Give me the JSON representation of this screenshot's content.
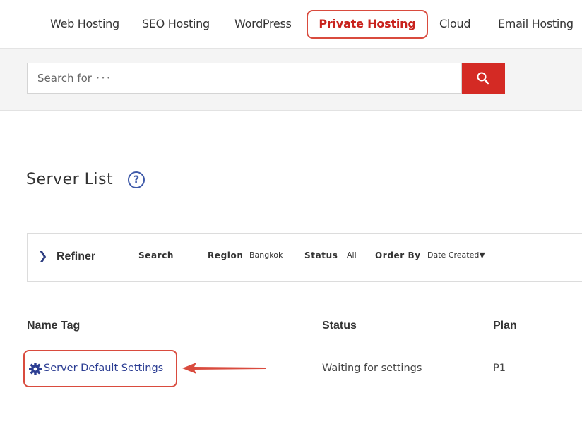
{
  "nav": {
    "items": [
      "Web Hosting",
      "SEO Hosting",
      "WordPress",
      "Private Hosting",
      "Cloud",
      "Email Hosting"
    ],
    "active": "Private Hosting"
  },
  "search": {
    "placeholder": "Search for ･･･"
  },
  "page": {
    "title": "Server List",
    "help_glyph": "?"
  },
  "refiner": {
    "label": "Refiner",
    "filters": {
      "search_key": "Search",
      "search_val": "−",
      "region_key": "Region",
      "region_val": "Bangkok",
      "status_key": "Status",
      "status_val": "All",
      "order_key": "Order By",
      "order_val": "Date Created▼"
    }
  },
  "table": {
    "headers": [
      "Name Tag",
      "Status",
      "Plan"
    ],
    "rows": [
      {
        "name": "Server Default Settings",
        "status": "Waiting for settings",
        "plan": "P1"
      }
    ]
  },
  "colors": {
    "accent_red": "#d42a24",
    "highlight_outline": "#d94b3e",
    "link_blue": "#2c3e93"
  }
}
